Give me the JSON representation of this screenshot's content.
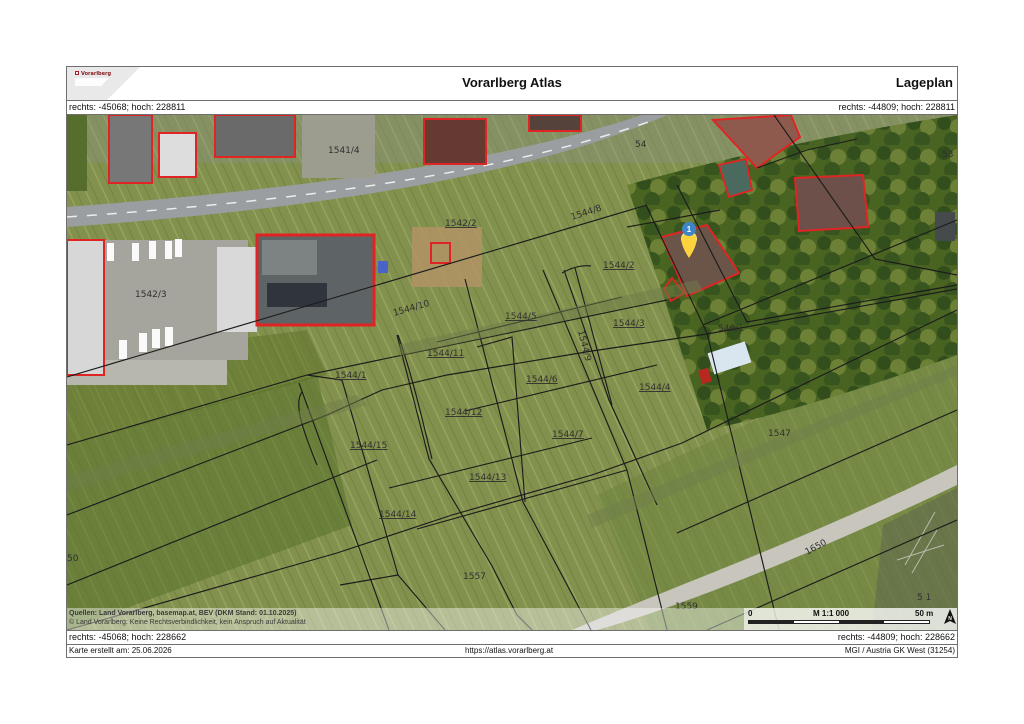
{
  "header": {
    "logo_text": "Vorarlberg",
    "title": "Vorarlberg Atlas",
    "subtitle": "Lageplan"
  },
  "coordinates": {
    "top_left": "rechts: -45068; hoch: 228811",
    "top_right": "rechts: -44809; hoch: 228811",
    "bottom_left": "rechts: -45068; hoch: 228662",
    "bottom_right": "rechts: -44809; hoch: 228662"
  },
  "map": {
    "parcels": [
      "1541/4",
      "1542/2",
      "1542/3",
      "1544/10",
      "1544/11",
      "1544/1",
      "1544/15",
      "1544/12",
      "1544/13",
      "1544/14",
      "1544/5",
      "1544/6",
      "1544/2",
      "1544/3",
      "1544/4",
      "1544/7",
      "1544/9",
      "1544/8",
      "540/1",
      "1547",
      "1557",
      "1559",
      "1650",
      "54",
      "53",
      "50",
      "5 1"
    ],
    "marker_label": "1",
    "marker_color": "#3d85c6",
    "highlight_color": "#ffd33d"
  },
  "sources": {
    "line1": "Quellen: Land Vorarlberg, basemap.at, BEV (DKM Stand: 01.10.2025)",
    "line2": "© Land Vorarlberg: Keine Rechtsverbindlichkeit, kein Anspruch auf Aktualität"
  },
  "scale": {
    "zero": "0",
    "ratio": "M 1:1 000",
    "distance": "50 m"
  },
  "footer": {
    "created": "Karte erstellt am: 25.06.2026",
    "url": "https://atlas.vorarlberg.at",
    "projection": "MGI / Austria GK West (31254)"
  }
}
